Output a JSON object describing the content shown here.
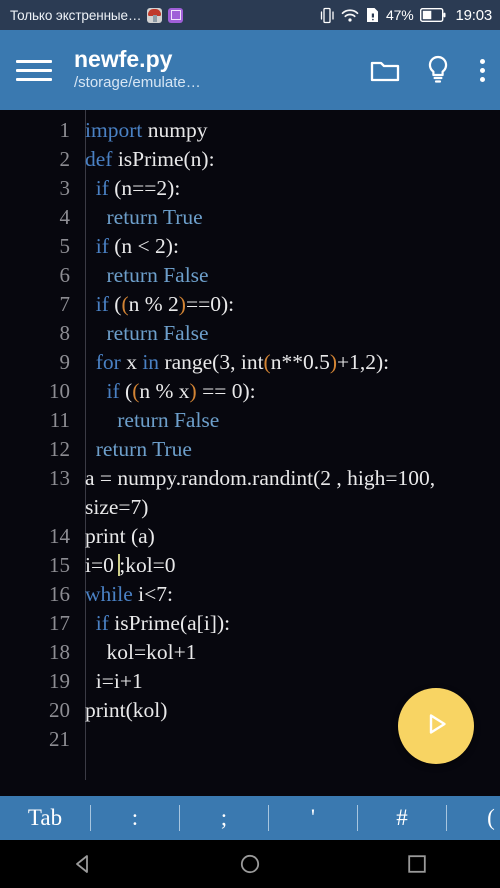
{
  "statusbar": {
    "carrier_text": "Только экстренные…",
    "battery_percent": "47%",
    "time": "19:03",
    "icons": [
      "mushroom-app-icon",
      "purple-app-icon",
      "vibrate-icon",
      "wifi-icon",
      "sim-card-icon",
      "battery-icon"
    ]
  },
  "appbar": {
    "menu_icon": "hamburger-menu-icon",
    "title": "newfe.py",
    "subtitle": "/storage/emulate…",
    "folder_icon": "folder-icon",
    "hint_icon": "lightbulb-icon",
    "overflow_icon": "kebab-menu-icon"
  },
  "editor": {
    "total_lines": 21,
    "lines": [
      {
        "n": "1",
        "html": "<span class='kw'>import</span> numpy"
      },
      {
        "n": "2",
        "html": "<span class='kw'>def</span> isPrime(n):"
      },
      {
        "n": "3",
        "html": "  <span class='kw'>if</span> (n==2):"
      },
      {
        "n": "4",
        "html": "    <span class='kw2'>return True</span>"
      },
      {
        "n": "5",
        "html": "  <span class='kw'>if</span> (n &lt; 2):"
      },
      {
        "n": "6",
        "html": "    <span class='kw2'>return False</span>"
      },
      {
        "n": "7",
        "html": "  <span class='kw'>if</span> (<span class='br'>(</span>n % 2<span class='br'>)</span>==0):"
      },
      {
        "n": "8",
        "html": "    <span class='kw2'>return False</span>"
      },
      {
        "n": "9",
        "html": "  <span class='kw'>for</span> x <span class='kw'>in</span> range(3, int<span class='br'>(</span>n**0.5<span class='br'>)</span>+1,2):"
      },
      {
        "n": "10",
        "html": "    <span class='kw'>if</span> (<span class='br'>(</span>n % x<span class='br'>)</span> == 0):"
      },
      {
        "n": "11",
        "html": "      <span class='kw2'>return False</span>"
      },
      {
        "n": "12",
        "html": "  <span class='kw2'>return True</span>"
      },
      {
        "n": "13",
        "html": "a = numpy.random.randint(2 , high=100, size=7)"
      },
      {
        "n": "14",
        "html": "print (a)"
      },
      {
        "n": "15",
        "html": "i=0 <span class='caret'></span>;kol=0"
      },
      {
        "n": "16",
        "html": "<span class='kw'>while</span> i&lt;7:"
      },
      {
        "n": "17",
        "html": "  <span class='kw'>if</span> isPrime(a[i]):"
      },
      {
        "n": "18",
        "html": "    kol=kol+1"
      },
      {
        "n": "19",
        "html": "  i=i+1"
      },
      {
        "n": "20",
        "html": "print(kol)"
      },
      {
        "n": "21",
        "html": ""
      }
    ],
    "plain_text": "import numpy\ndef isPrime(n):\n  if (n==2):\n    return True\n  if (n < 2):\n    return False\n  if ((n % 2)==0):\n    return False\n  for x in range(3, int(n**0.5)+1,2):\n    if ((n % x) == 0):\n      return False\n  return True\na = numpy.random.randint(2 , high=100, size=7)\nprint (a)\ni=0 ;kol=0\nwhile i<7:\n  if isPrime(a[i]):\n    kol=kol+1\n  i=i+1\nprint(kol)\n"
  },
  "fab": {
    "icon": "play-icon",
    "label": "Run"
  },
  "symbol_toolbar": {
    "items": [
      {
        "label": "Tab",
        "name": "tab"
      },
      {
        "label": ":",
        "name": "colon"
      },
      {
        "label": ";",
        "name": "semicolon"
      },
      {
        "label": "'",
        "name": "apostrophe"
      },
      {
        "label": "#",
        "name": "hash"
      },
      {
        "label": "(",
        "name": "open-paren"
      }
    ]
  },
  "navbar": {
    "back": "back-icon",
    "home": "home-icon",
    "recents": "recents-icon"
  },
  "colors": {
    "statusbar_bg": "#2b3b53",
    "appbar_bg": "#3a79b0",
    "editor_bg": "#07070e",
    "keyword": "#4a81c4",
    "keyword_alt": "#6d9fcb",
    "bracket_match": "#d38434",
    "fab": "#f8d463",
    "line_number": "#8d8d93",
    "code_text": "#e9e9ea"
  }
}
